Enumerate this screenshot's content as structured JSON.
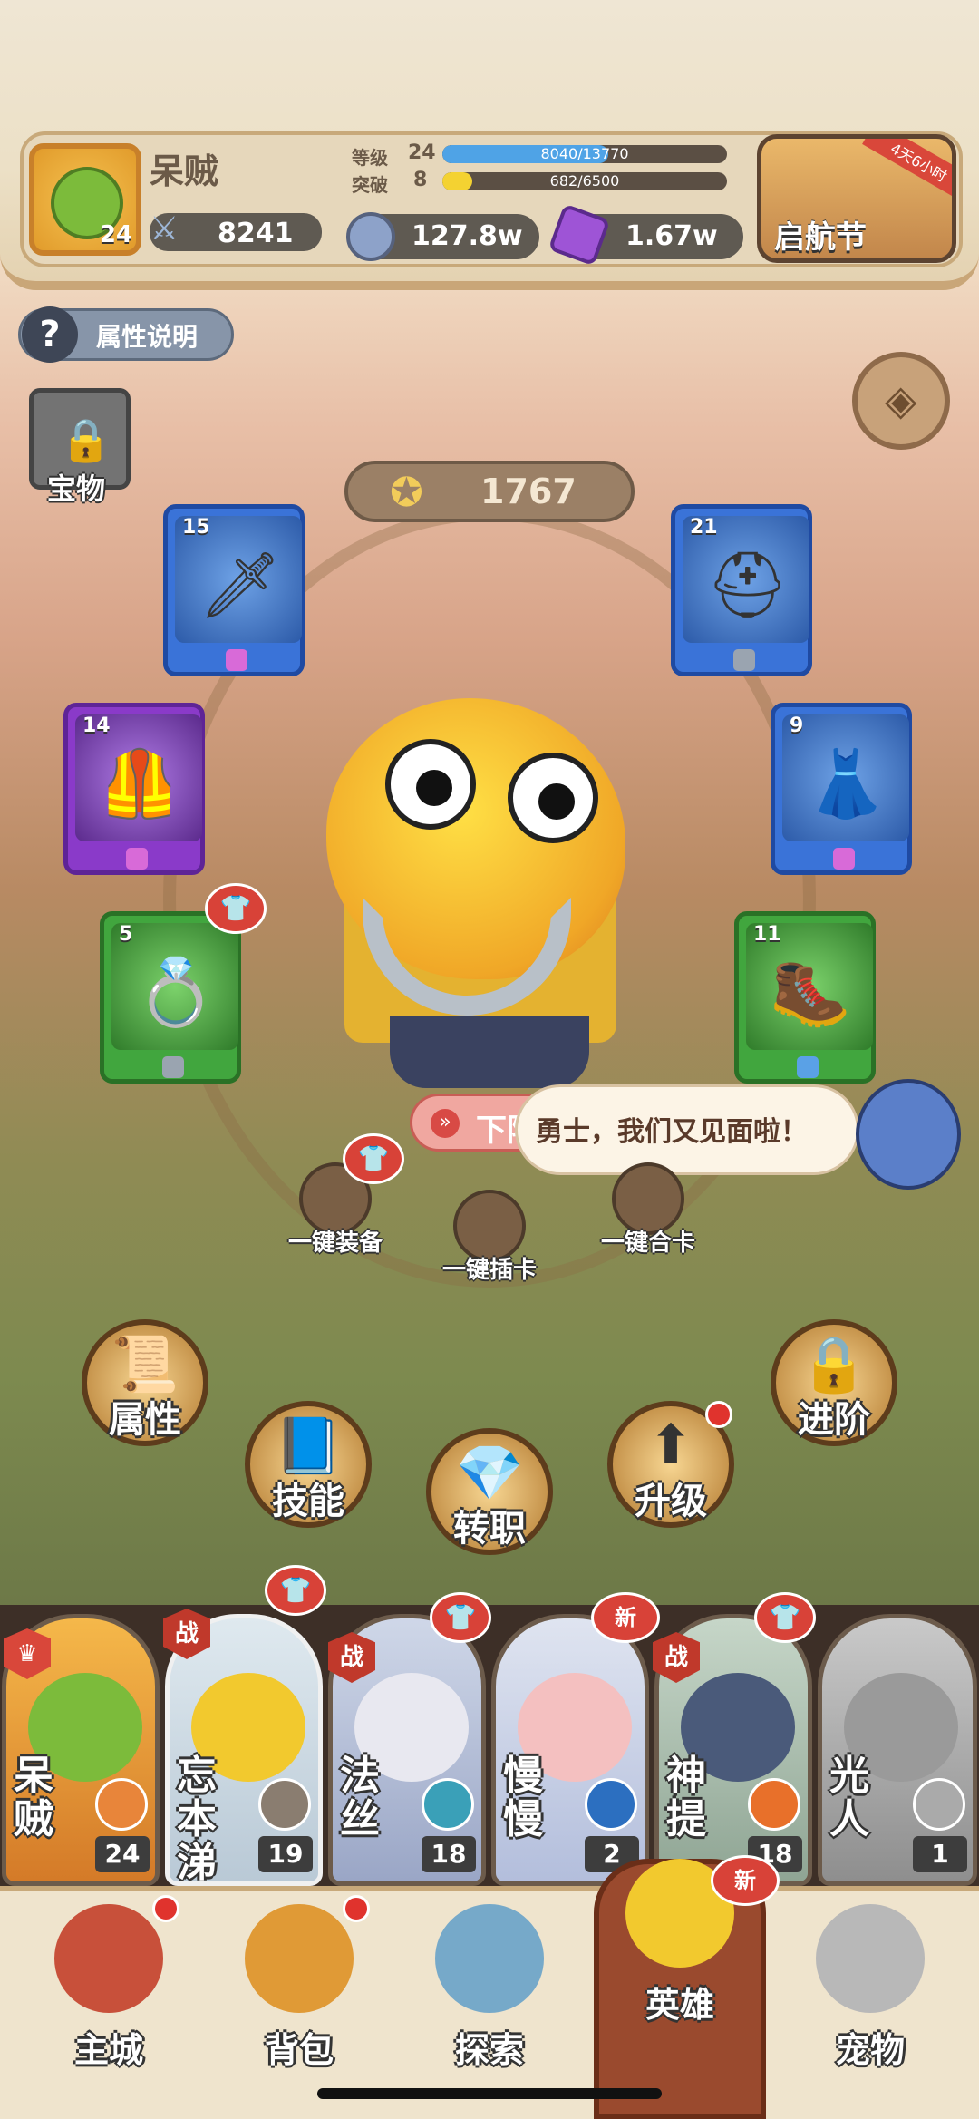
{
  "player": {
    "name": "呆贼",
    "level": "24",
    "power": "8241"
  },
  "stats": {
    "grade_label": "等级",
    "grade_value": "24",
    "grade_progress_text": "8040/13770",
    "grade_progress": 0.584,
    "breakthrough_label": "突破",
    "breakthrough_value": "8",
    "breakthrough_progress_text": "682/6500",
    "breakthrough_progress": 0.105
  },
  "currency": {
    "coins": "127.8w",
    "gems": "1.67w"
  },
  "event": {
    "title": "启航节",
    "timer": "4天6小时"
  },
  "help_label": "属性说明",
  "treasure_label": "宝物",
  "hero_score": "1767",
  "equipment": [
    {
      "slot": "weapon",
      "level": "15",
      "icon": "sword-icon",
      "rarity": "blue"
    },
    {
      "slot": "helmet",
      "level": "21",
      "icon": "helmet-icon",
      "rarity": "blue"
    },
    {
      "slot": "armor",
      "level": "14",
      "icon": "armor-icon",
      "rarity": "purple"
    },
    {
      "slot": "clothes",
      "level": "9",
      "icon": "dress-icon",
      "rarity": "blue"
    },
    {
      "slot": "ring",
      "level": "5",
      "icon": "ring-icon",
      "rarity": "green"
    },
    {
      "slot": "boots",
      "level": "11",
      "icon": "boots-icon",
      "rarity": "green"
    }
  ],
  "down_button_label": "下阵",
  "speech_text": "勇士，我们又见面啦！",
  "quick_actions": {
    "equip_all": "一键装备",
    "insert_card": "一键插卡",
    "merge_card": "一键合卡"
  },
  "actions": {
    "attributes": "属性",
    "skills": "技能",
    "job_change": "转职",
    "upgrade": "升级",
    "advance": "进阶"
  },
  "roster": [
    {
      "name": "呆贼",
      "level": "24",
      "tag": "",
      "color": "#7cbb3b"
    },
    {
      "name": "忘本涕",
      "level": "19",
      "tag": "战",
      "color": "#f2c92e"
    },
    {
      "name": "法丝",
      "level": "18",
      "tag": "战",
      "color": "#e8e8f0"
    },
    {
      "name": "慢慢",
      "level": "2",
      "tag": "",
      "color": "#f4c0c0"
    },
    {
      "name": "神提",
      "level": "18",
      "tag": "战",
      "color": "#4a5a7a"
    },
    {
      "name": "光人",
      "level": "1",
      "tag": "",
      "color": "#9a9a9a"
    }
  ],
  "roster_tags": {
    "war": "战",
    "new": "新",
    "new_label_roster": "新",
    "new_label_nav": "新"
  },
  "nav": {
    "city": "主城",
    "bag": "背包",
    "explore": "探索",
    "hero": "英雄",
    "pet": "宠物"
  }
}
